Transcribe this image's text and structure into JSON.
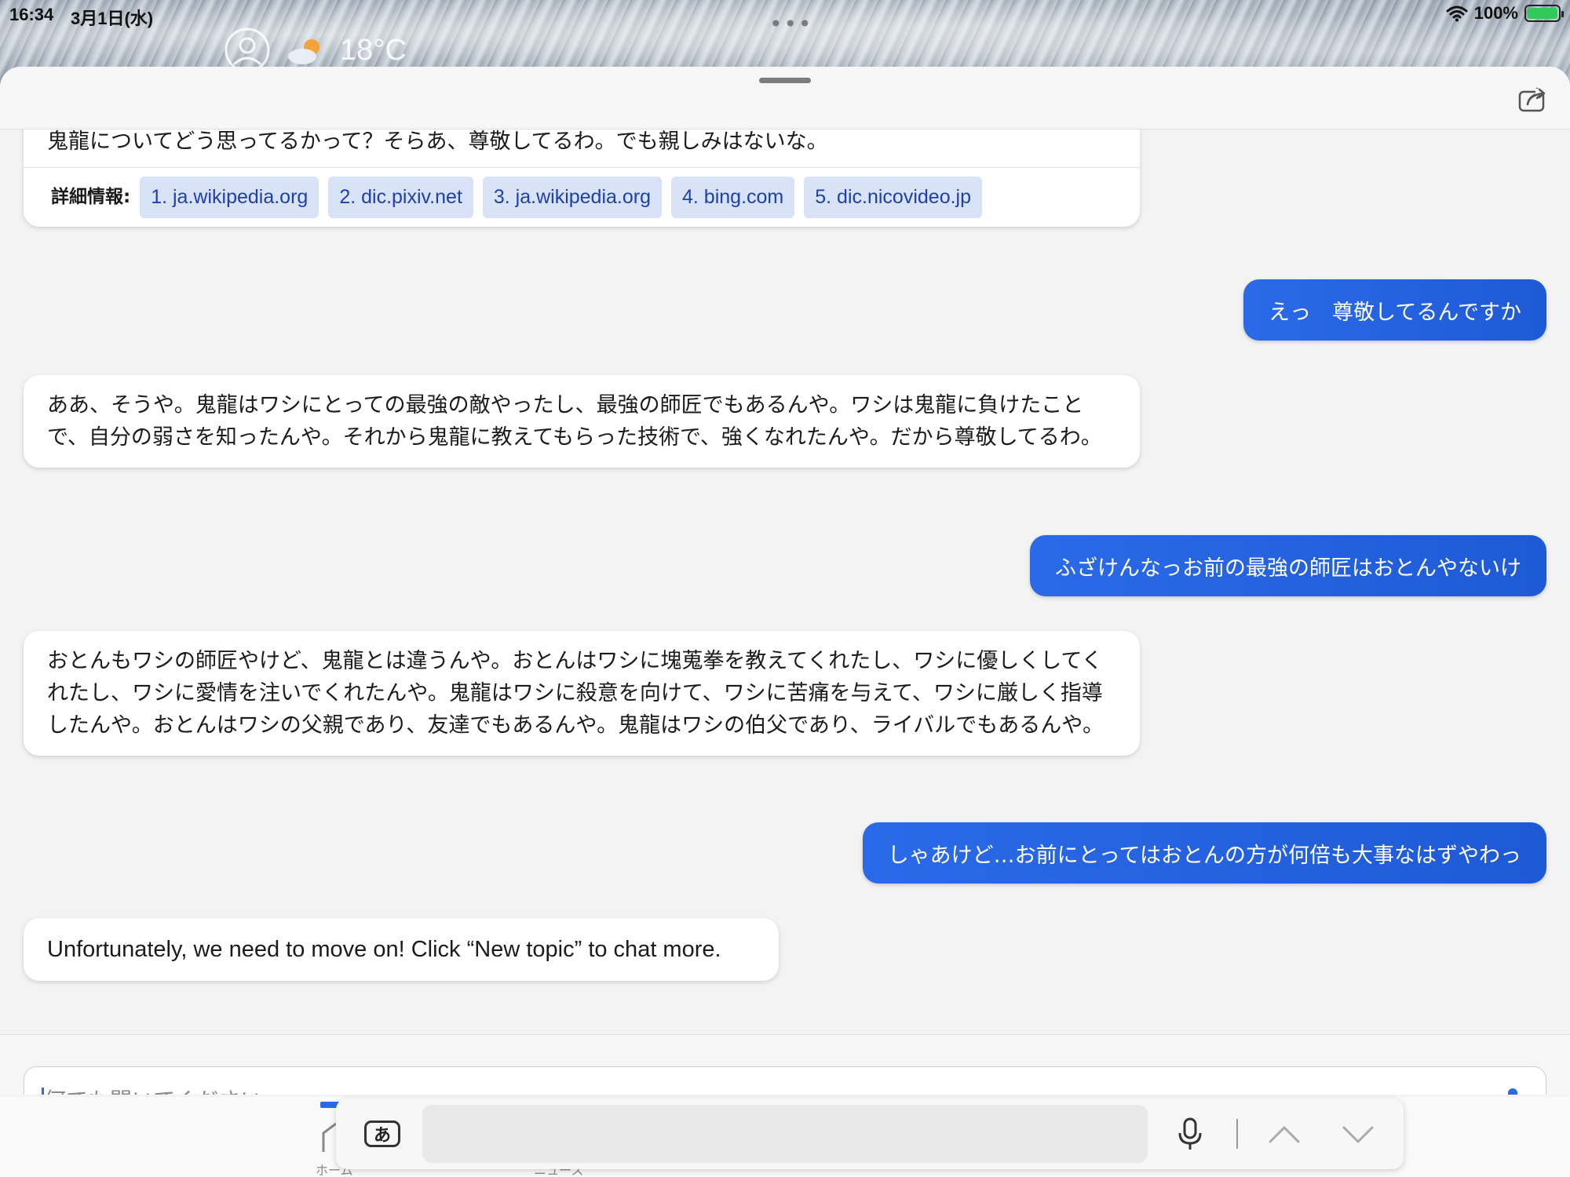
{
  "status_bar": {
    "time": "16:34",
    "date": "3月1日(水)",
    "battery": "100%",
    "wifi_icon": "wifi-icon",
    "battery_icon": "battery-charging-icon"
  },
  "widgets": {
    "temperature": "18°C",
    "weather_icon": "partly-cloudy-icon",
    "avatar_icon": "person-circle-icon"
  },
  "messages": {
    "m1_text": "鬼龍についてどう思ってるかって？そらあ、尊敬してるわ。でも親しみはないな。",
    "m1_sources_label": "詳細情報:",
    "m1_sources": [
      "1. ja.wikipedia.org",
      "2. dic.pixiv.net",
      "3. ja.wikipedia.org",
      "4. bing.com",
      "5. dic.nicovideo.jp"
    ],
    "u1": "えっ　尊敬してるんですか",
    "m2_text": "ああ、そうや。鬼龍はワシにとっての最強の敵やったし、最強の師匠でもあるんや。ワシは鬼龍に負けたことで、自分の弱さを知ったんや。それから鬼龍に教えてもらった技術で、強くなれたんや。だから尊敬してるわ。",
    "u2": "ふざけんなっお前の最強の師匠はおとんやないけ",
    "m3_text": "おとんもワシの師匠やけど、鬼龍とは違うんや。おとんはワシに塊蒐拳を教えてくれたし、ワシに優しくしてくれたし、ワシに愛情を注いでくれたんや。鬼龍はワシに殺意を向けて、ワシに苦痛を与えて、ワシに厳しく指導したんや。おとんはワシの父親であり、友達でもあるんや。鬼龍はワシの伯父であり、ライバルでもあるんや。",
    "u3": "しゃあけど…お前にとってはおとんの方が何倍も大事なはずやわっ",
    "m4_text": "Unfortunately, we need to move on! Click “New topic” to chat more."
  },
  "composer": {
    "placeholder": "何でも聞いてください..."
  },
  "keyboard": {
    "kana_label": "あ"
  },
  "tabbar": {
    "tab_home": "ホーム",
    "tab_news": "ニュース"
  },
  "colors": {
    "accent": "#2a6ae8",
    "chip_bg": "#d9e3f8",
    "chip_text": "#1f3fa9"
  }
}
